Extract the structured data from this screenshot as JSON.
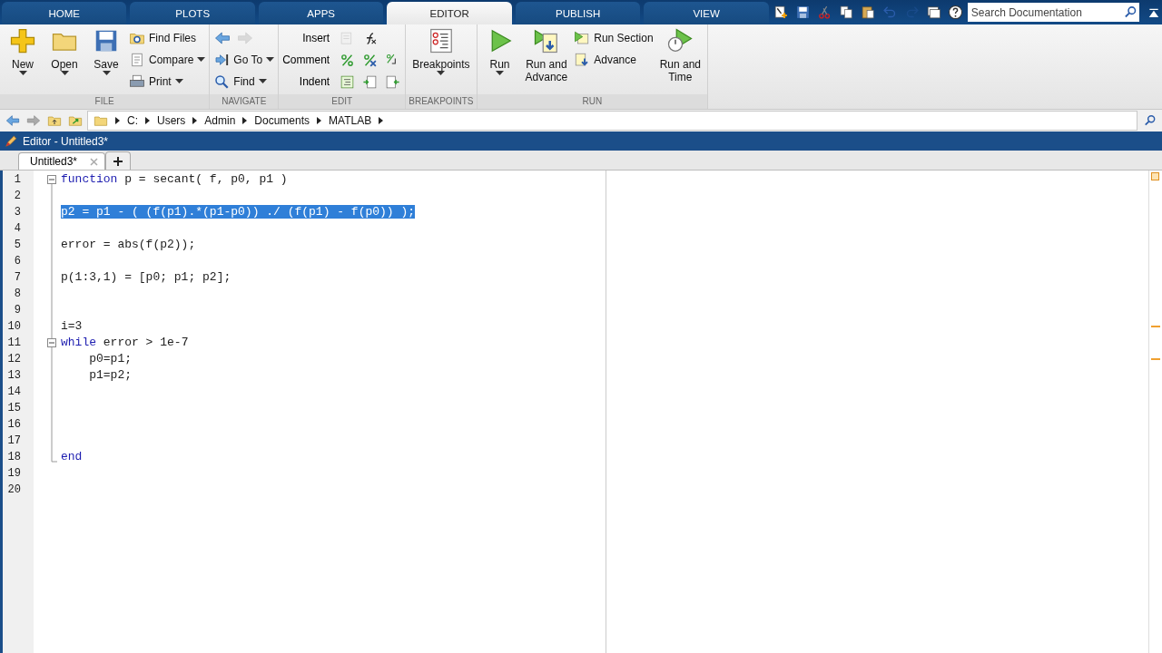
{
  "tabs": [
    {
      "label": "HOME",
      "selected": false
    },
    {
      "label": "PLOTS",
      "selected": false
    },
    {
      "label": "APPS",
      "selected": false
    },
    {
      "label": "EDITOR",
      "selected": true
    },
    {
      "label": "PUBLISH",
      "selected": false
    },
    {
      "label": "VIEW",
      "selected": false
    }
  ],
  "quick_access": [
    {
      "disabled": false
    },
    {
      "disabled": false
    },
    {
      "disabled": false
    },
    {
      "disabled": false
    },
    {
      "disabled": false
    },
    {
      "disabled": false
    },
    {
      "disabled": true
    },
    {
      "disabled": false
    },
    {
      "disabled": false
    }
  ],
  "search": {
    "placeholder": "Search Documentation"
  },
  "ribbon": {
    "groups": [
      {
        "label": "FILE",
        "items": [
          {
            "kind": "large",
            "label": "New",
            "dropdown": true
          },
          {
            "kind": "large",
            "label": "Open",
            "dropdown": true
          },
          {
            "kind": "large",
            "label": "Save",
            "dropdown": true
          },
          {
            "kind": "small",
            "label": "Find Files",
            "dropdown": false
          },
          {
            "kind": "small",
            "label": "Compare",
            "dropdown": true
          },
          {
            "kind": "small",
            "label": "Print",
            "dropdown": true
          }
        ]
      },
      {
        "label": "NAVIGATE",
        "items": [
          {
            "kind": "arrows",
            "buttons": [
              {
                "disabled": false
              },
              {
                "disabled": true
              }
            ]
          },
          {
            "kind": "small",
            "label": "Go To",
            "dropdown": true
          },
          {
            "kind": "small",
            "label": "Find",
            "dropdown": true
          }
        ]
      },
      {
        "label": "EDIT",
        "items": [
          {
            "kind": "iconrow",
            "label": "Insert",
            "buttons": [
              {
                "disabled": true
              },
              {
                "disabled": false
              }
            ]
          },
          {
            "kind": "iconrow",
            "label": "Comment",
            "buttons": [
              {
                "disabled": false
              },
              {
                "disabled": false
              },
              {
                "disabled": false
              }
            ]
          },
          {
            "kind": "iconrow",
            "label": "Indent",
            "buttons": [
              {
                "disabled": false
              },
              {
                "disabled": false
              },
              {
                "disabled": false
              }
            ]
          }
        ]
      },
      {
        "label": "BREAKPOINTS",
        "items": [
          {
            "kind": "large",
            "label": "Breakpoints",
            "dropdown": true
          }
        ]
      },
      {
        "label": "RUN",
        "items": [
          {
            "kind": "large",
            "label": "Run",
            "dropdown": true
          },
          {
            "kind": "large",
            "label": "Run and\nAdvance",
            "dropdown": false
          },
          {
            "kind": "small",
            "label": "Run Section",
            "dropdown": false
          },
          {
            "kind": "small",
            "label": "Advance",
            "dropdown": false
          },
          {
            "kind": "large",
            "label": "Run and\nTime",
            "dropdown": false
          }
        ]
      }
    ]
  },
  "address": {
    "path": [
      "C:",
      "Users",
      "Admin",
      "Documents",
      "MATLAB"
    ]
  },
  "editor": {
    "title": "Editor - Untitled3*",
    "doc_tabs": [
      {
        "label": "Untitled3*",
        "selected": true
      }
    ],
    "lines": [
      {
        "number": "1",
        "selected": false,
        "segments": [
          {
            "kind": "keyword",
            "text": "function"
          },
          {
            "kind": "plain",
            "text": " p = secant( f, p0, p1 )"
          }
        ]
      },
      {
        "number": "2",
        "selected": false
      },
      {
        "number": "3",
        "selected": true,
        "segments": [
          {
            "kind": "plain",
            "text": "p2 = p1 - ( (f(p1).*(p1-p0)) ./ (f(p1) - f(p0)) );"
          }
        ]
      },
      {
        "number": "4",
        "selected": false
      },
      {
        "number": "5",
        "selected": false,
        "segments": [
          {
            "kind": "plain",
            "text": "error = abs(f(p2));"
          }
        ]
      },
      {
        "number": "6",
        "selected": false
      },
      {
        "number": "7",
        "selected": false,
        "segments": [
          {
            "kind": "plain",
            "text": "p(1:3,1) = [p0; p1; p2];"
          }
        ]
      },
      {
        "number": "8",
        "selected": false
      },
      {
        "number": "9",
        "selected": false
      },
      {
        "number": "10",
        "selected": false,
        "segments": [
          {
            "kind": "plain",
            "text": "i=3"
          }
        ]
      },
      {
        "number": "11",
        "selected": false,
        "segments": [
          {
            "kind": "keyword",
            "text": "while"
          },
          {
            "kind": "plain",
            "text": " error > 1e-7"
          }
        ]
      },
      {
        "number": "12",
        "selected": false,
        "segments": [
          {
            "kind": "plain",
            "text": "    p0=p1;"
          }
        ]
      },
      {
        "number": "13",
        "selected": false,
        "segments": [
          {
            "kind": "plain",
            "text": "    p1=p2;"
          }
        ]
      },
      {
        "number": "14",
        "selected": false
      },
      {
        "number": "15",
        "selected": false
      },
      {
        "number": "16",
        "selected": false
      },
      {
        "number": "17",
        "selected": false
      },
      {
        "number": "18",
        "selected": false,
        "segments": [
          {
            "kind": "keyword",
            "text": "end"
          }
        ]
      },
      {
        "number": "19",
        "selected": false
      },
      {
        "number": "20",
        "selected": false
      }
    ]
  }
}
